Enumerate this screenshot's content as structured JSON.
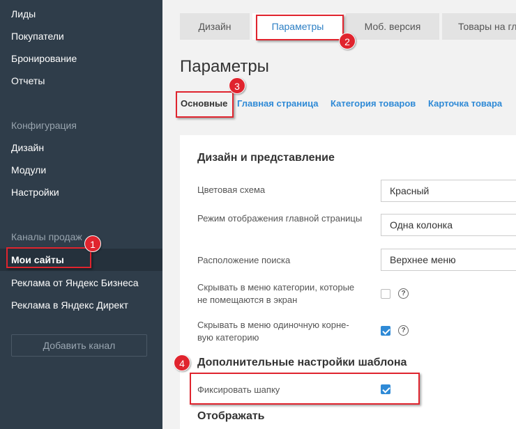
{
  "sidebar": {
    "top_items": [
      {
        "label": "Лиды"
      },
      {
        "label": "Покупатели"
      },
      {
        "label": "Бронирование"
      },
      {
        "label": "Отчеты"
      }
    ],
    "config_label": "Конфигурация",
    "config_items": [
      {
        "label": "Дизайн"
      },
      {
        "label": "Модули"
      },
      {
        "label": "Настройки"
      }
    ],
    "channels_label": "Каналы продаж",
    "channel_items": [
      {
        "label": "Мои сайты"
      },
      {
        "label": "Реклама от Яндекс Бизнеса"
      },
      {
        "label": "Реклама в Яндекс Директ"
      }
    ],
    "add_channel_label": "Добавить канал"
  },
  "tabs": [
    {
      "label": "Дизайн"
    },
    {
      "label": "Параметры"
    },
    {
      "label": "Моб. версия"
    },
    {
      "label": "Товары на гл"
    }
  ],
  "page_title": "Параметры",
  "subtabs": [
    {
      "label": "Основные"
    },
    {
      "label": "Главная страница"
    },
    {
      "label": "Категория товаров"
    },
    {
      "label": "Карточка товара"
    }
  ],
  "design_section": {
    "heading": "Дизайн и представление",
    "color_scheme_label": "Цветовая схема",
    "color_scheme_value": "Красный",
    "home_mode_label": "Режим отображения главной страницы",
    "home_mode_value": "Одна колонка",
    "search_position_label": "Расположение поиска",
    "search_position_value": "Верхнее меню",
    "hide_categories_label": "Скрывать в меню категории, которые не помещаются в экран",
    "hide_categories_checked": false,
    "hide_single_root_label": "Скрывать в меню одиночную корне-вую категорию",
    "hide_single_root_checked": true,
    "help_glyph": "?"
  },
  "template_section": {
    "heading": "Дополнительные настройки шаблона",
    "fix_header_label": "Фиксировать шапку",
    "fix_header_checked": true
  },
  "display_section": {
    "heading": "Отображать"
  },
  "annotations": {
    "badge1": "1",
    "badge2": "2",
    "badge3": "3",
    "badge4": "4"
  },
  "colors": {
    "sidebar_bg": "#2f3d4a",
    "accent_blue": "#2f8ad6",
    "annotation_red": "#e0242e"
  }
}
